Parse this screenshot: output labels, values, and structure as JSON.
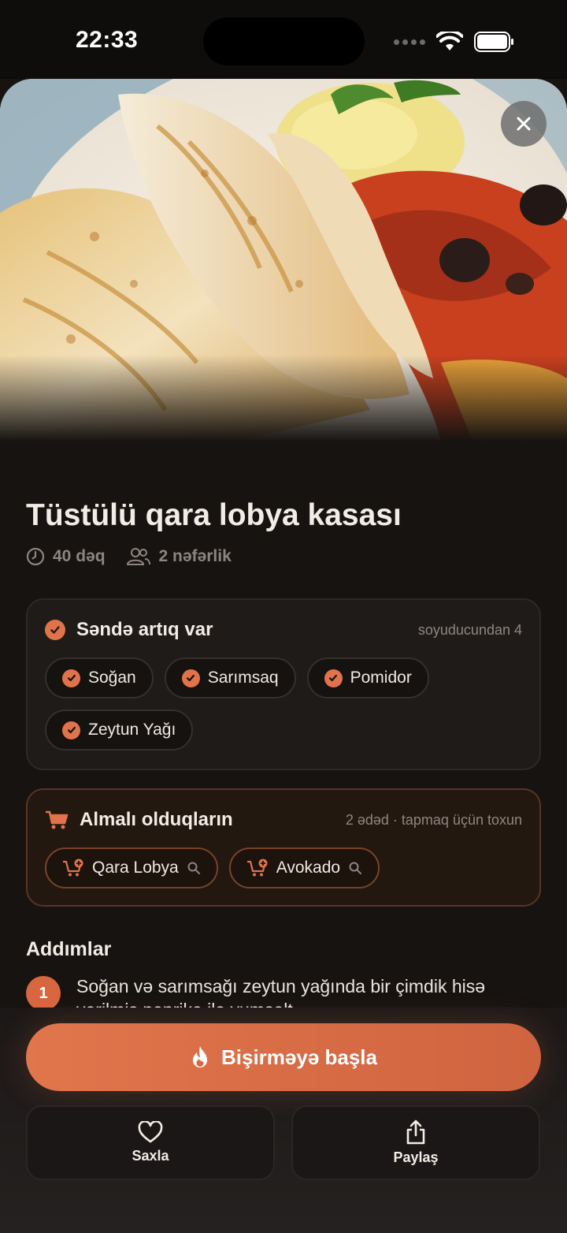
{
  "status_bar": {
    "time": "22:33"
  },
  "recipe": {
    "title": "Tüstülü qara lobya kasası",
    "time": "40 dəq",
    "servings": "2 nəfərlik"
  },
  "have_section": {
    "title": "Səndə artıq var",
    "aside": "soyuducundan 4",
    "items": [
      "Soğan",
      "Sarımsaq",
      "Pomidor",
      "Zeytun Yağı"
    ]
  },
  "need_section": {
    "title": "Almalı olduqların",
    "aside": "2 ədəd · tapmaq üçün toxun",
    "items": [
      "Qara Lobya",
      "Avokado"
    ]
  },
  "steps": {
    "title": "Addımlar",
    "items": [
      {
        "number": "1",
        "text": "Soğan və sarımsağı zeytun yağında bir çimdik hisə verilmiş paprika ilə yumşalt."
      }
    ]
  },
  "actions": {
    "start": "Bişirməyə başla",
    "save": "Saxla",
    "share": "Paylaş"
  },
  "colors": {
    "accent": "#e0734a",
    "background": "#161311"
  },
  "icons": [
    "clock-icon",
    "people-icon",
    "check-icon",
    "cart-icon",
    "cart-plus-icon",
    "search-icon",
    "flame-icon",
    "heart-icon",
    "share-icon",
    "close-icon",
    "wifi-icon",
    "battery-icon"
  ]
}
